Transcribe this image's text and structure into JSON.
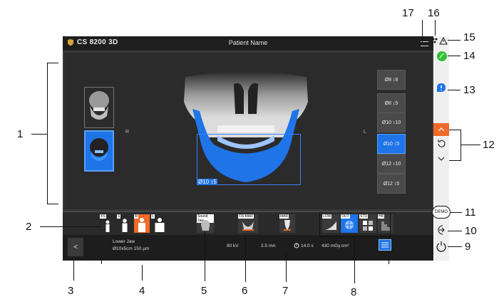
{
  "window": {
    "app_title": "CS 8200 3D",
    "patient_name": "Patient Name"
  },
  "viewer": {
    "side_right": "R",
    "side_left": "L",
    "fov_buttons": [
      {
        "label": "Ø8 ↕8",
        "selected": false
      },
      {
        "label": "Ø8 ↕5",
        "selected": false
      },
      {
        "label": "Ø10 ↕10",
        "selected": false
      },
      {
        "label": "Ø10 ↕5",
        "selected": true
      },
      {
        "label": "Ø12 ↕10",
        "selected": false
      },
      {
        "label": "Ø12 ↕5",
        "selected": false
      }
    ],
    "fov_region_label": "Ø10 ↕5"
  },
  "toolbar": {
    "patient_labels": [
      "XS",
      "S",
      "M",
      "L"
    ],
    "patient_selected": "M",
    "sound_label": "Sound Jaw",
    "ortho_label": "OS MAR",
    "implant_label": "MAR",
    "image_modes": [
      "LOW",
      "OUT",
      "STD",
      "HR"
    ],
    "image_mode_selected": "OUT"
  },
  "statusbar": {
    "back_symbol": "<",
    "region_name": "Lower Jaw",
    "region_detail": "Ø10x5cm 150 µm",
    "kv": "90 kV",
    "ma": "2.5 mA",
    "time": "14.0 s",
    "dose": "430 mGy.cm²"
  },
  "sidebar": {
    "demo_label": "DEMO"
  },
  "callouts": [
    "1",
    "2",
    "3",
    "4",
    "5",
    "6",
    "7",
    "8",
    "9",
    "10",
    "11",
    "12",
    "13",
    "14",
    "15",
    "16",
    "17"
  ],
  "colors": {
    "accent_blue": "#1f74e8",
    "accent_orange": "#f06a2a",
    "status_green": "#2fbf3a"
  }
}
